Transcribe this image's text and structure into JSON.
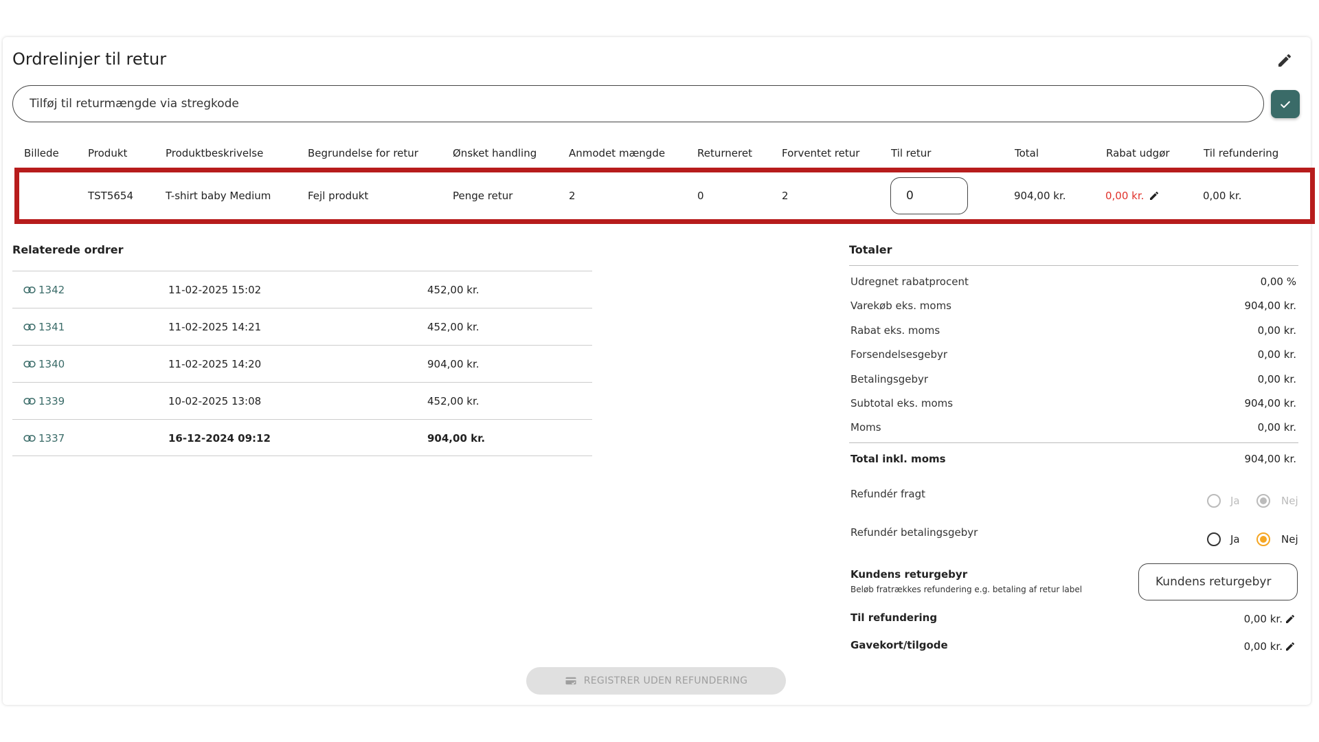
{
  "page": {
    "title": "Ordrelinjer til retur"
  },
  "barcode": {
    "placeholder": "Tilføj til returmængde via stregkode"
  },
  "table": {
    "headers": [
      "Billede",
      "Produkt",
      "Produktbeskrivelse",
      "Begrundelse for retur",
      "Ønsket handling",
      "Anmodet mængde",
      "Returneret",
      "Forventet retur",
      "Til retur",
      "Total",
      "Rabat udgør",
      "Til refundering"
    ],
    "row": {
      "image": "",
      "product": "TST5654",
      "description": "T-shirt baby Medium",
      "reason": "Fejl produkt",
      "action": "Penge retur",
      "requested": "2",
      "returned": "0",
      "expected": "2",
      "to_return": "0",
      "total": "904,00 kr.",
      "discount": "0,00 kr.",
      "refund": "0,00 kr."
    }
  },
  "related": {
    "title": "Relaterede ordrer",
    "rows": [
      {
        "id": "1342",
        "date": "11-02-2025 15:02",
        "amount": "452,00 kr."
      },
      {
        "id": "1341",
        "date": "11-02-2025 14:21",
        "amount": "452,00 kr."
      },
      {
        "id": "1340",
        "date": "11-02-2025 14:20",
        "amount": "904,00 kr."
      },
      {
        "id": "1339",
        "date": "10-02-2025 13:08",
        "amount": "452,00 kr."
      },
      {
        "id": "1337",
        "date": "16-12-2024 09:12",
        "amount": "904,00 kr."
      }
    ]
  },
  "totals": {
    "title": "Totaler",
    "rows": [
      {
        "label": "Udregnet rabatprocent",
        "value": "0,00 %"
      },
      {
        "label": "Varekøb eks. moms",
        "value": "904,00 kr."
      },
      {
        "label": "Rabat eks. moms",
        "value": "0,00 kr."
      },
      {
        "label": "Forsendelsesgebyr",
        "value": "0,00 kr."
      },
      {
        "label": "Betalingsgebyr",
        "value": "0,00 kr."
      },
      {
        "label": "Subtotal eks. moms",
        "value": "904,00 kr."
      },
      {
        "label": "Moms",
        "value": "0,00 kr."
      }
    ],
    "total_incl": {
      "label": "Total inkl. moms",
      "value": "904,00 kr."
    },
    "refund_freight": {
      "label": "Refundér fragt",
      "yes": "Ja",
      "no": "Nej",
      "selected": "no",
      "disabled": true
    },
    "refund_payment_fee": {
      "label": "Refundér betalingsgebyr",
      "yes": "Ja",
      "no": "Nej",
      "selected": "no"
    },
    "customer_fee": {
      "label": "Kundens returgebyr",
      "description": "Beløb fratrækkes refundering e.g. betaling af retur label",
      "placeholder": "Kundens returgebyr"
    },
    "to_refund": {
      "label": "Til refundering",
      "value": "0,00 kr."
    },
    "gift_card": {
      "label": "Gavekort/tilgode",
      "value": "0,00 kr."
    }
  },
  "actions": {
    "register_label": "REGISTRER UDEN REFUNDERING"
  },
  "colors": {
    "accent": "#3a6b68",
    "highlight": "#b71c1c",
    "radio_selected": "#f5a623",
    "discount": "#e0322b"
  }
}
